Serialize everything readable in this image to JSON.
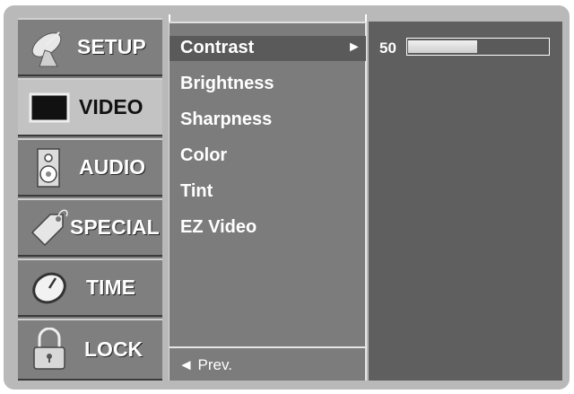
{
  "sidebar": {
    "items": [
      {
        "label": "SETUP",
        "icon": "satellite-dish-icon",
        "selected": false
      },
      {
        "label": "VIDEO",
        "icon": "tv-screen-icon",
        "selected": true
      },
      {
        "label": "AUDIO",
        "icon": "speaker-icon",
        "selected": false
      },
      {
        "label": "SPECIAL",
        "icon": "tag-icon",
        "selected": false
      },
      {
        "label": "TIME",
        "icon": "clock-icon",
        "selected": false
      },
      {
        "label": "LOCK",
        "icon": "padlock-icon",
        "selected": false
      }
    ]
  },
  "menu": {
    "items": [
      {
        "label": "Contrast",
        "selected": true
      },
      {
        "label": "Brightness",
        "selected": false
      },
      {
        "label": "Sharpness",
        "selected": false
      },
      {
        "label": "Color",
        "selected": false
      },
      {
        "label": "Tint",
        "selected": false
      },
      {
        "label": "EZ Video",
        "selected": false
      }
    ],
    "selected_arrow": "►",
    "prev_label": "◄ Prev."
  },
  "detail": {
    "value": "50",
    "level": 0.5
  },
  "colors": {
    "frame": "#b9b9b9",
    "sidebar_selected": "#c3c3c3",
    "panel": "#7c7c7c",
    "detail_panel": "#5f5f5f"
  }
}
